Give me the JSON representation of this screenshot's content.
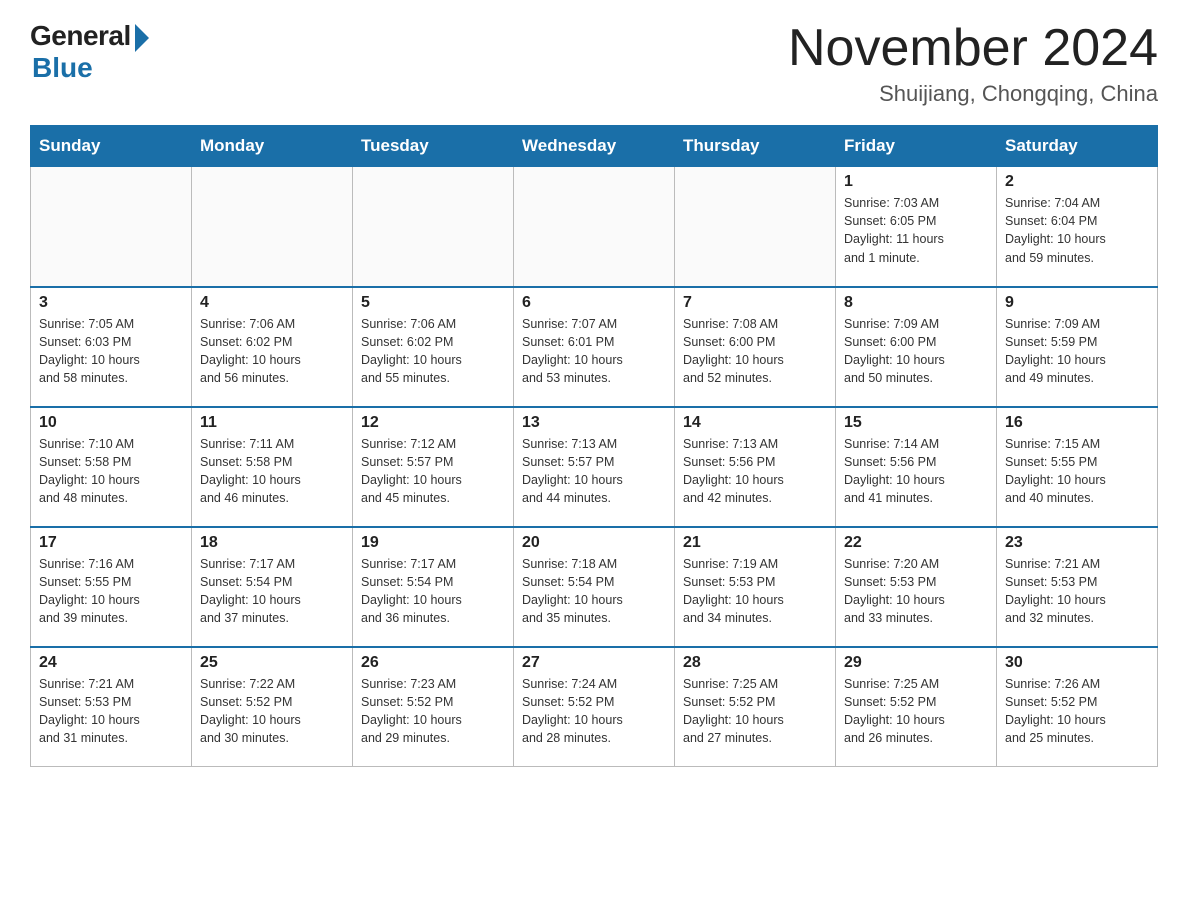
{
  "header": {
    "logo_general": "General",
    "logo_blue": "Blue",
    "month_title": "November 2024",
    "location": "Shuijiang, Chongqing, China"
  },
  "weekdays": [
    "Sunday",
    "Monday",
    "Tuesday",
    "Wednesday",
    "Thursday",
    "Friday",
    "Saturday"
  ],
  "weeks": [
    [
      {
        "day": "",
        "info": ""
      },
      {
        "day": "",
        "info": ""
      },
      {
        "day": "",
        "info": ""
      },
      {
        "day": "",
        "info": ""
      },
      {
        "day": "",
        "info": ""
      },
      {
        "day": "1",
        "info": "Sunrise: 7:03 AM\nSunset: 6:05 PM\nDaylight: 11 hours\nand 1 minute."
      },
      {
        "day": "2",
        "info": "Sunrise: 7:04 AM\nSunset: 6:04 PM\nDaylight: 10 hours\nand 59 minutes."
      }
    ],
    [
      {
        "day": "3",
        "info": "Sunrise: 7:05 AM\nSunset: 6:03 PM\nDaylight: 10 hours\nand 58 minutes."
      },
      {
        "day": "4",
        "info": "Sunrise: 7:06 AM\nSunset: 6:02 PM\nDaylight: 10 hours\nand 56 minutes."
      },
      {
        "day": "5",
        "info": "Sunrise: 7:06 AM\nSunset: 6:02 PM\nDaylight: 10 hours\nand 55 minutes."
      },
      {
        "day": "6",
        "info": "Sunrise: 7:07 AM\nSunset: 6:01 PM\nDaylight: 10 hours\nand 53 minutes."
      },
      {
        "day": "7",
        "info": "Sunrise: 7:08 AM\nSunset: 6:00 PM\nDaylight: 10 hours\nand 52 minutes."
      },
      {
        "day": "8",
        "info": "Sunrise: 7:09 AM\nSunset: 6:00 PM\nDaylight: 10 hours\nand 50 minutes."
      },
      {
        "day": "9",
        "info": "Sunrise: 7:09 AM\nSunset: 5:59 PM\nDaylight: 10 hours\nand 49 minutes."
      }
    ],
    [
      {
        "day": "10",
        "info": "Sunrise: 7:10 AM\nSunset: 5:58 PM\nDaylight: 10 hours\nand 48 minutes."
      },
      {
        "day": "11",
        "info": "Sunrise: 7:11 AM\nSunset: 5:58 PM\nDaylight: 10 hours\nand 46 minutes."
      },
      {
        "day": "12",
        "info": "Sunrise: 7:12 AM\nSunset: 5:57 PM\nDaylight: 10 hours\nand 45 minutes."
      },
      {
        "day": "13",
        "info": "Sunrise: 7:13 AM\nSunset: 5:57 PM\nDaylight: 10 hours\nand 44 minutes."
      },
      {
        "day": "14",
        "info": "Sunrise: 7:13 AM\nSunset: 5:56 PM\nDaylight: 10 hours\nand 42 minutes."
      },
      {
        "day": "15",
        "info": "Sunrise: 7:14 AM\nSunset: 5:56 PM\nDaylight: 10 hours\nand 41 minutes."
      },
      {
        "day": "16",
        "info": "Sunrise: 7:15 AM\nSunset: 5:55 PM\nDaylight: 10 hours\nand 40 minutes."
      }
    ],
    [
      {
        "day": "17",
        "info": "Sunrise: 7:16 AM\nSunset: 5:55 PM\nDaylight: 10 hours\nand 39 minutes."
      },
      {
        "day": "18",
        "info": "Sunrise: 7:17 AM\nSunset: 5:54 PM\nDaylight: 10 hours\nand 37 minutes."
      },
      {
        "day": "19",
        "info": "Sunrise: 7:17 AM\nSunset: 5:54 PM\nDaylight: 10 hours\nand 36 minutes."
      },
      {
        "day": "20",
        "info": "Sunrise: 7:18 AM\nSunset: 5:54 PM\nDaylight: 10 hours\nand 35 minutes."
      },
      {
        "day": "21",
        "info": "Sunrise: 7:19 AM\nSunset: 5:53 PM\nDaylight: 10 hours\nand 34 minutes."
      },
      {
        "day": "22",
        "info": "Sunrise: 7:20 AM\nSunset: 5:53 PM\nDaylight: 10 hours\nand 33 minutes."
      },
      {
        "day": "23",
        "info": "Sunrise: 7:21 AM\nSunset: 5:53 PM\nDaylight: 10 hours\nand 32 minutes."
      }
    ],
    [
      {
        "day": "24",
        "info": "Sunrise: 7:21 AM\nSunset: 5:53 PM\nDaylight: 10 hours\nand 31 minutes."
      },
      {
        "day": "25",
        "info": "Sunrise: 7:22 AM\nSunset: 5:52 PM\nDaylight: 10 hours\nand 30 minutes."
      },
      {
        "day": "26",
        "info": "Sunrise: 7:23 AM\nSunset: 5:52 PM\nDaylight: 10 hours\nand 29 minutes."
      },
      {
        "day": "27",
        "info": "Sunrise: 7:24 AM\nSunset: 5:52 PM\nDaylight: 10 hours\nand 28 minutes."
      },
      {
        "day": "28",
        "info": "Sunrise: 7:25 AM\nSunset: 5:52 PM\nDaylight: 10 hours\nand 27 minutes."
      },
      {
        "day": "29",
        "info": "Sunrise: 7:25 AM\nSunset: 5:52 PM\nDaylight: 10 hours\nand 26 minutes."
      },
      {
        "day": "30",
        "info": "Sunrise: 7:26 AM\nSunset: 5:52 PM\nDaylight: 10 hours\nand 25 minutes."
      }
    ]
  ]
}
